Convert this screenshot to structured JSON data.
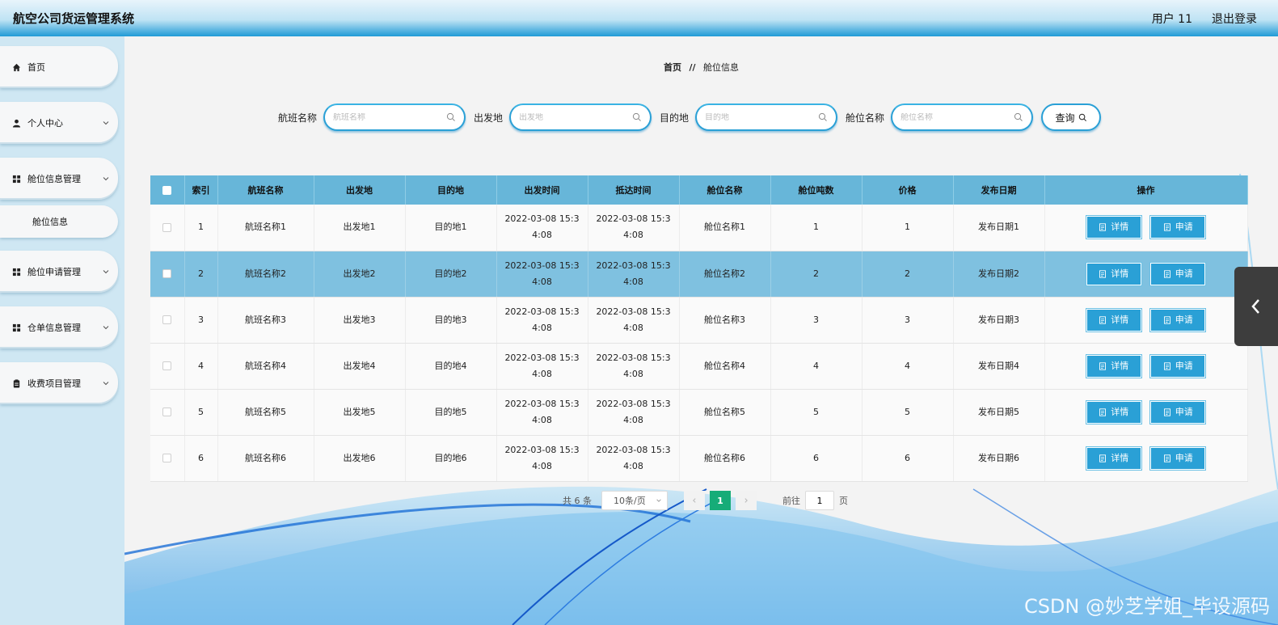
{
  "header": {
    "title": "航空公司货运管理系统",
    "user": "用户 11",
    "logout": "退出登录"
  },
  "sidebar": {
    "items": [
      {
        "label": "首页",
        "icon": "home-icon"
      },
      {
        "label": "个人中心",
        "icon": "person-icon"
      },
      {
        "label": "舱位信息管理",
        "icon": "grid-icon"
      },
      {
        "label": "舱位信息",
        "icon": ""
      },
      {
        "label": "舱位申请管理",
        "icon": "grid-icon"
      },
      {
        "label": "仓单信息管理",
        "icon": "grid-icon"
      },
      {
        "label": "收费项目管理",
        "icon": "clipboard-icon"
      }
    ]
  },
  "breadcrumb": {
    "home": "首页",
    "sep": "//",
    "current": "舱位信息"
  },
  "search": {
    "fields": [
      {
        "label": "航班名称",
        "placeholder": "航班名称"
      },
      {
        "label": "出发地",
        "placeholder": "出发地"
      },
      {
        "label": "目的地",
        "placeholder": "目的地"
      },
      {
        "label": "舱位名称",
        "placeholder": "舱位名称"
      }
    ],
    "button": "查询"
  },
  "table": {
    "headers": [
      "索引",
      "航班名称",
      "出发地",
      "目的地",
      "出发时间",
      "抵达时间",
      "舱位名称",
      "舱位吨数",
      "价格",
      "发布日期",
      "操作"
    ],
    "rows": [
      {
        "idx": "1",
        "flight": "航班名称1",
        "from": "出发地1",
        "to": "目的地1",
        "dep1": "2022-03-08 15:3",
        "dep2": "4:08",
        "arr1": "2022-03-08 15:3",
        "arr2": "4:08",
        "cabin": "舱位名称1",
        "tons": "1",
        "price": "1",
        "date": "发布日期1"
      },
      {
        "idx": "2",
        "flight": "航班名称2",
        "from": "出发地2",
        "to": "目的地2",
        "dep1": "2022-03-08 15:3",
        "dep2": "4:08",
        "arr1": "2022-03-08 15:3",
        "arr2": "4:08",
        "cabin": "舱位名称2",
        "tons": "2",
        "price": "2",
        "date": "发布日期2"
      },
      {
        "idx": "3",
        "flight": "航班名称3",
        "from": "出发地3",
        "to": "目的地3",
        "dep1": "2022-03-08 15:3",
        "dep2": "4:08",
        "arr1": "2022-03-08 15:3",
        "arr2": "4:08",
        "cabin": "舱位名称3",
        "tons": "3",
        "price": "3",
        "date": "发布日期3"
      },
      {
        "idx": "4",
        "flight": "航班名称4",
        "from": "出发地4",
        "to": "目的地4",
        "dep1": "2022-03-08 15:3",
        "dep2": "4:08",
        "arr1": "2022-03-08 15:3",
        "arr2": "4:08",
        "cabin": "舱位名称4",
        "tons": "4",
        "price": "4",
        "date": "发布日期4"
      },
      {
        "idx": "5",
        "flight": "航班名称5",
        "from": "出发地5",
        "to": "目的地5",
        "dep1": "2022-03-08 15:3",
        "dep2": "4:08",
        "arr1": "2022-03-08 15:3",
        "arr2": "4:08",
        "cabin": "舱位名称5",
        "tons": "5",
        "price": "5",
        "date": "发布日期5"
      },
      {
        "idx": "6",
        "flight": "航班名称6",
        "from": "出发地6",
        "to": "目的地6",
        "dep1": "2022-03-08 15:3",
        "dep2": "4:08",
        "arr1": "2022-03-08 15:3",
        "arr2": "4:08",
        "cabin": "舱位名称6",
        "tons": "6",
        "price": "6",
        "date": "发布日期6"
      }
    ],
    "actions": {
      "detail": "详情",
      "apply": "申请"
    }
  },
  "pagination": {
    "total": "共 6 条",
    "page_size": "10条/页",
    "current": "1",
    "goto_prefix": "前往",
    "goto_value": "1",
    "goto_suffix": "页"
  },
  "watermark": "CSDN @妙芝学姐_毕设源码",
  "colors": {
    "accent": "#2aa0d6",
    "header_row": "#67b6d9",
    "highlight_row": "#7fc1e0",
    "page_active": "#16ac78"
  }
}
